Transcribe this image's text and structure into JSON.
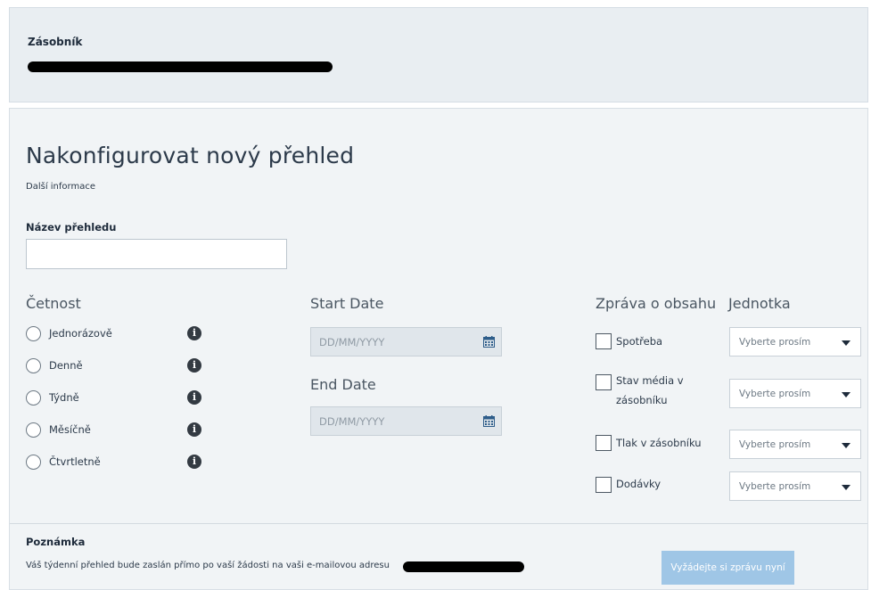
{
  "tank": {
    "label": "Zásobník"
  },
  "form": {
    "title": "Nakonfigurovat nový přehled",
    "more_info": "Další informace",
    "name_label": "Název přehledu",
    "name_value": ""
  },
  "frequency": {
    "heading": "Četnost",
    "options": [
      {
        "label": "Jednorázově"
      },
      {
        "label": "Denně"
      },
      {
        "label": "Týdně"
      },
      {
        "label": "Měsíčně"
      },
      {
        "label": "Čtvrtletně"
      }
    ],
    "info_icon": "info-circle-icon"
  },
  "dates": {
    "start_heading": "Start Date",
    "start_placeholder": "DD/MM/YYYY",
    "end_heading": "End Date",
    "end_placeholder": "DD/MM/YYYY",
    "icon": "calendar-icon"
  },
  "content": {
    "heading": "Zpráva o obsahu",
    "unit_heading": "Jednotka",
    "items": [
      {
        "label": "Spotřeba",
        "unit": "Vyberte prosím"
      },
      {
        "label": "Stav média v zásobníku",
        "unit": "Vyberte prosím"
      },
      {
        "label": "Tlak v zásobníku",
        "unit": "Vyberte prosím"
      },
      {
        "label": "Dodávky",
        "unit": "Vyberte prosím"
      }
    ]
  },
  "note": {
    "heading": "Poznámka",
    "text": "Váš týdenní přehled bude zaslán přímo po vaší žádosti na vaši e-mailovou adresu",
    "button": "Vyžádejte si zprávu nyní"
  },
  "colors": {
    "panel_bg": "#f1f4f6",
    "button_bg": "#9fc6e6",
    "date_input_bg": "#e0e6eb"
  }
}
